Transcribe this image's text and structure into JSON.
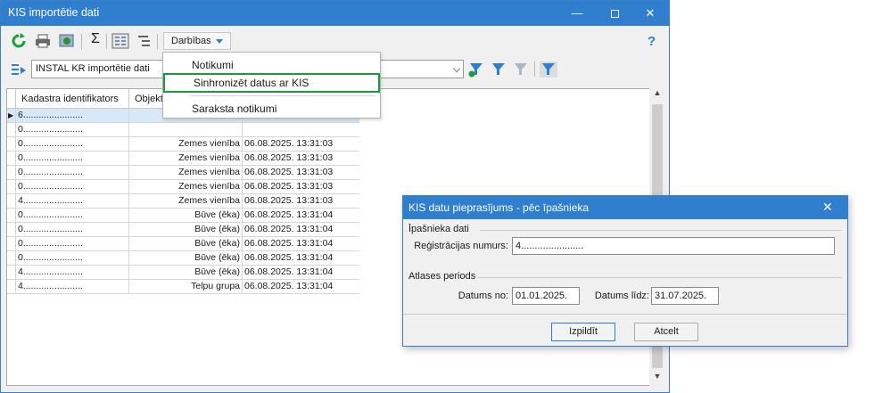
{
  "main_window": {
    "title": "KIS importētie dati",
    "min_glyph": "—",
    "close_glyph": "✕",
    "help_glyph": "?"
  },
  "toolbar": {
    "sigma": "Σ",
    "darbibas_label": "Darbības"
  },
  "menu": {
    "items": [
      "Notikumi",
      "Sinhronizēt datus ar KIS",
      "Saraksta notikumi"
    ],
    "highlighted_index": 1
  },
  "filter": {
    "selected": "INSTAL KR importētie dati"
  },
  "grid": {
    "columns": [
      "Kadastra identifikators",
      "Objekta"
    ],
    "rows": [
      {
        "id": "6.......................",
        "type": "",
        "date": ""
      },
      {
        "id": "0.......................",
        "type": "",
        "date": ""
      },
      {
        "id": "0.......................",
        "type": "Zemes vienība",
        "date": "06.08.2025. 13:31:03"
      },
      {
        "id": "0.......................",
        "type": "Zemes vienība",
        "date": "06.08.2025. 13:31:03"
      },
      {
        "id": "0.......................",
        "type": "Zemes vienība",
        "date": "06.08.2025. 13:31:03"
      },
      {
        "id": "0.......................",
        "type": "Zemes vienība",
        "date": "06.08.2025. 13:31:03"
      },
      {
        "id": "4.......................",
        "type": "Zemes vienība",
        "date": "06.08.2025. 13:31:03"
      },
      {
        "id": "0.......................",
        "type": "Būve (ēka)",
        "date": "06.08.2025. 13:31:04"
      },
      {
        "id": "0.......................",
        "type": "Būve (ēka)",
        "date": "06.08.2025. 13:31:04"
      },
      {
        "id": "0.......................",
        "type": "Būve (ēka)",
        "date": "06.08.2025. 13:31:04"
      },
      {
        "id": "0.......................",
        "type": "Būve (ēka)",
        "date": "06.08.2025. 13:31:04"
      },
      {
        "id": "4.......................",
        "type": "Būve (ēka)",
        "date": "06.08.2025. 13:31:04"
      },
      {
        "id": "4.......................",
        "type": "Telpu grupa",
        "date": "06.08.2025. 13:31:04"
      }
    ]
  },
  "dialog": {
    "title": "KIS datu pieprasījums - pēc īpašnieka",
    "close_glyph": "✕",
    "owner_group": "Īpašnieka dati",
    "reg_label": "Reģistrācijas numurs:",
    "reg_value": "4.......................",
    "period_group": "Atlases periods",
    "from_label": "Datums no:",
    "from_value": "01.01.2025.",
    "to_label": "Datums līdz:",
    "to_value": "31.07.2025.",
    "run_label": "Izpildīt",
    "cancel_label": "Atcelt"
  },
  "colors": {
    "title_bar": "#2f7fce",
    "menu_highlight_border": "#1a9a3a",
    "selected_row": "#d7e9f9"
  },
  "icons": [
    "refresh-icon",
    "print-icon",
    "export-icon",
    "sum-icon",
    "columns-icon",
    "tree-icon",
    "filter-add-icon",
    "filter-apply-icon",
    "filter-clear-icon",
    "filter-toggle-icon",
    "list-settings-icon"
  ]
}
